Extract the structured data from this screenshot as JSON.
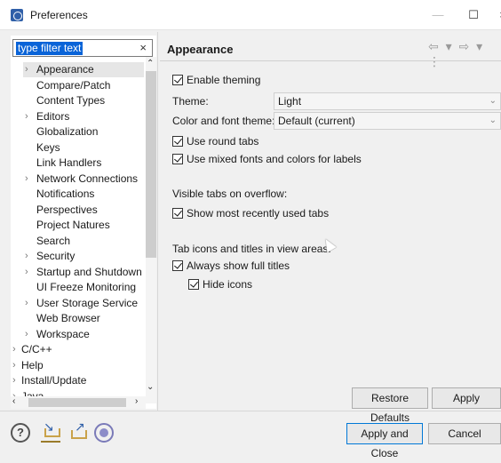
{
  "window": {
    "title": "Preferences",
    "min": "—",
    "max": "☐",
    "close": "×"
  },
  "filter": {
    "value": "type filter text",
    "clear": "×"
  },
  "tree": {
    "items": [
      {
        "label": "Appearance",
        "twisty": "›",
        "selected": true
      },
      {
        "label": "Compare/Patch",
        "twisty": ""
      },
      {
        "label": "Content Types",
        "twisty": ""
      },
      {
        "label": "Editors",
        "twisty": "›"
      },
      {
        "label": "Globalization",
        "twisty": ""
      },
      {
        "label": "Keys",
        "twisty": ""
      },
      {
        "label": "Link Handlers",
        "twisty": ""
      },
      {
        "label": "Network Connections",
        "twisty": "›"
      },
      {
        "label": "Notifications",
        "twisty": ""
      },
      {
        "label": "Perspectives",
        "twisty": ""
      },
      {
        "label": "Project Natures",
        "twisty": ""
      },
      {
        "label": "Search",
        "twisty": ""
      },
      {
        "label": "Security",
        "twisty": "›"
      },
      {
        "label": "Startup and Shutdown",
        "twisty": "›"
      },
      {
        "label": "UI Freeze Monitoring",
        "twisty": ""
      },
      {
        "label": "User Storage Service",
        "twisty": "›"
      },
      {
        "label": "Web Browser",
        "twisty": ""
      },
      {
        "label": "Workspace",
        "twisty": "›"
      },
      {
        "label": "C/C++",
        "twisty": "›"
      },
      {
        "label": "Help",
        "twisty": "›"
      },
      {
        "label": "Install/Update",
        "twisty": "›"
      },
      {
        "label": "Java",
        "twisty": "›"
      }
    ]
  },
  "page": {
    "title": "Appearance",
    "enable_theming": "Enable theming",
    "theme_label": "Theme:",
    "theme_value": "Light",
    "color_font_label": "Color and font theme:",
    "color_font_value": "Default (current)",
    "use_round_tabs": "Use round tabs",
    "use_mixed_fonts": "Use mixed fonts and colors for labels",
    "visible_tabs_heading": "Visible tabs on overflow:",
    "show_recent_tabs": "Show most recently used tabs",
    "tab_icons_heading": "Tab icons and titles in view areas:",
    "always_show_full_titles": "Always show full titles",
    "hide_icons": "Hide icons",
    "restore_defaults": "Restore Defaults",
    "apply": "Apply"
  },
  "footer": {
    "apply_and_close": "Apply and Close",
    "cancel": "Cancel",
    "help": "?"
  }
}
